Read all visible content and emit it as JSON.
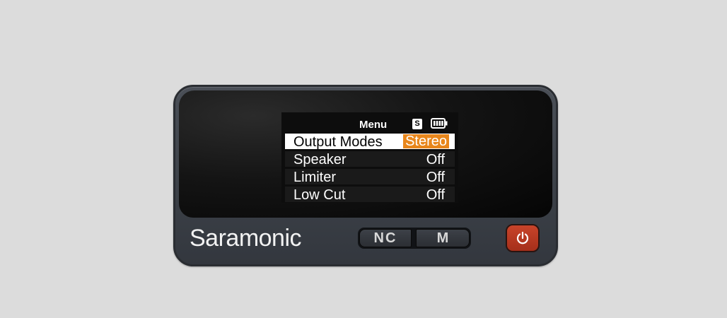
{
  "device": {
    "brand": "Saramonic"
  },
  "menu": {
    "title": "Menu",
    "status_badge": "S",
    "battery_icon": "battery-full-icon",
    "items": [
      {
        "label": "Output Modes",
        "value": "Stereo",
        "selected": true
      },
      {
        "label": "Speaker",
        "value": "Off",
        "selected": false
      },
      {
        "label": "Limiter",
        "value": "Off",
        "selected": false
      },
      {
        "label": "Low Cut",
        "value": "Off",
        "selected": false
      }
    ]
  },
  "buttons": {
    "nc_label": "NC",
    "m_label": "M",
    "power_icon": "power-icon"
  },
  "colors": {
    "accent": "#e8861b",
    "power": "#c8442a",
    "background": "#dcdcdc"
  }
}
